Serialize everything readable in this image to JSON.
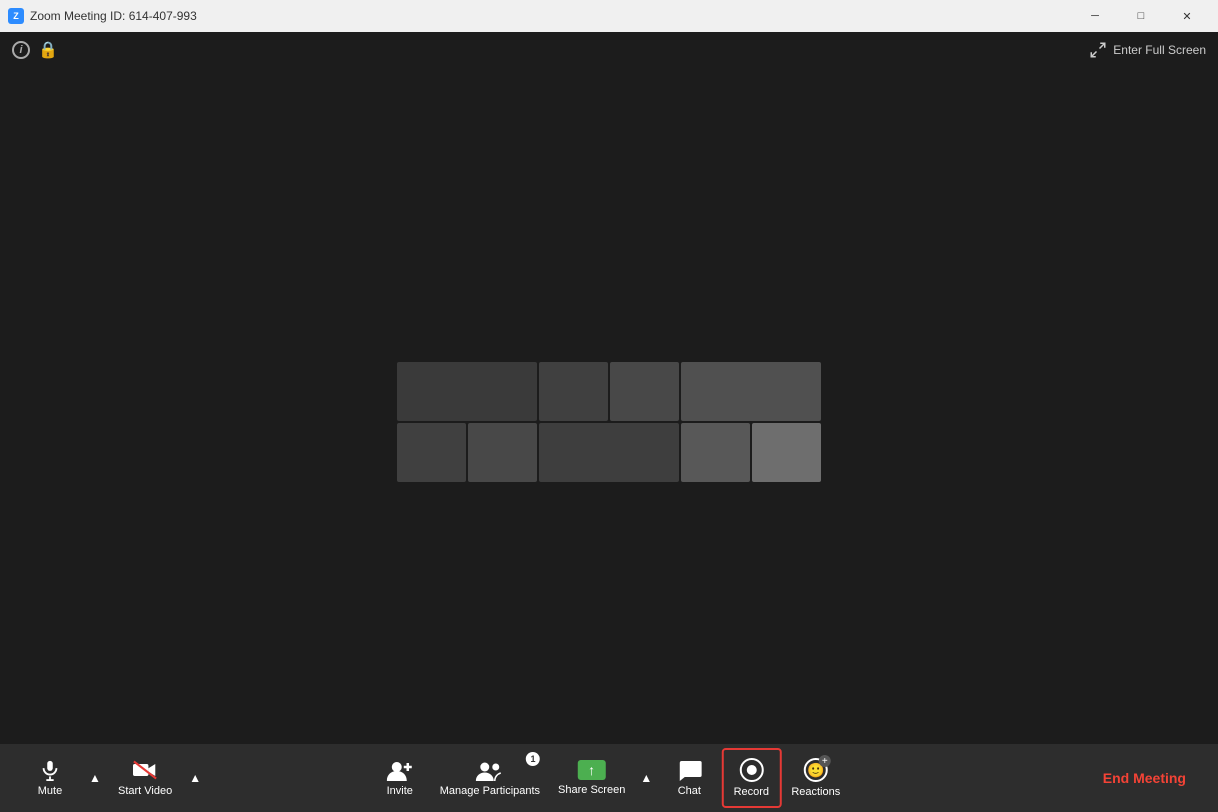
{
  "titleBar": {
    "title": "Zoom Meeting ID: 614-407-993",
    "minimize": "─",
    "maximize": "□",
    "close": "✕"
  },
  "topBar": {
    "infoIcon": "i",
    "fullscreenLabel": "Enter Full Screen"
  },
  "toolbar": {
    "muteLabel": "Mute",
    "startVideoLabel": "Start Video",
    "inviteLabel": "Invite",
    "manageParticipantsLabel": "Manage Participants",
    "participantCount": "1",
    "shareScreenLabel": "Share Screen",
    "chatLabel": "Chat",
    "recordLabel": "Record",
    "reactionsLabel": "Reactions",
    "endMeetingLabel": "End Meeting"
  },
  "colors": {
    "accent": "#2D8CFF",
    "recordBorder": "#e53935",
    "endMeeting": "#f44336",
    "shareGreen": "#4caf50",
    "lockGreen": "#4caf50"
  }
}
